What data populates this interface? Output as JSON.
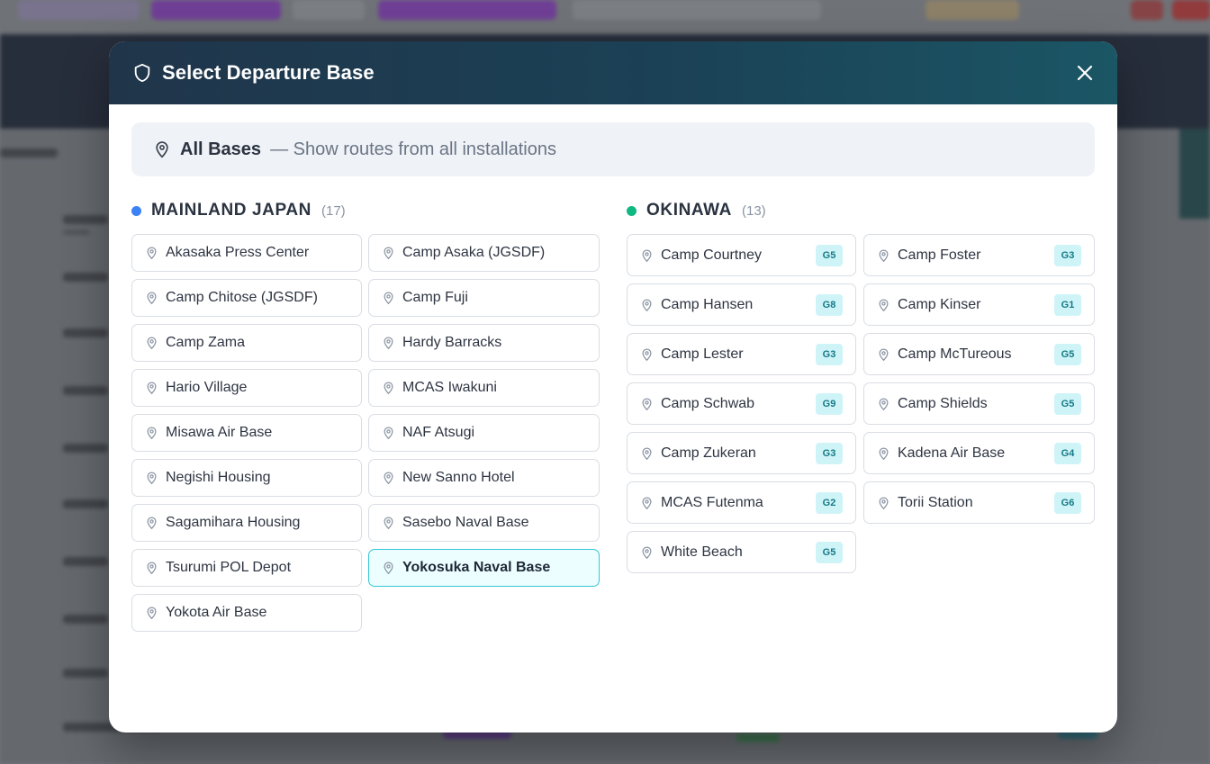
{
  "modal": {
    "title": "Select Departure Base",
    "all_bases": {
      "label": "All Bases",
      "description": "— Show routes from all installations"
    }
  },
  "regions": {
    "mainland": {
      "name": "MAINLAND JAPAN",
      "count": "(17)",
      "dot_color": "#3b82f6",
      "bases": [
        "Akasaka Press Center",
        "Camp Asaka (JGSDF)",
        "Camp Chitose (JGSDF)",
        "Camp Fuji",
        "Camp Zama",
        "Hardy Barracks",
        "Hario Village",
        "MCAS Iwakuni",
        "Misawa Air Base",
        "NAF Atsugi",
        "Negishi Housing",
        "New Sanno Hotel",
        "Sagamihara Housing",
        "Sasebo Naval Base",
        "Tsurumi POL Depot",
        "Yokosuka Naval Base",
        "Yokota Air Base"
      ],
      "selected": "Yokosuka Naval Base"
    },
    "okinawa": {
      "name": "OKINAWA",
      "count": "(13)",
      "dot_color": "#10b981",
      "bases": [
        {
          "name": "Camp Courtney",
          "gate": "G5"
        },
        {
          "name": "Camp Foster",
          "gate": "G3"
        },
        {
          "name": "Camp Hansen",
          "gate": "G8"
        },
        {
          "name": "Camp Kinser",
          "gate": "G1"
        },
        {
          "name": "Camp Lester",
          "gate": "G3"
        },
        {
          "name": "Camp McTureous",
          "gate": "G5"
        },
        {
          "name": "Camp Schwab",
          "gate": "G9"
        },
        {
          "name": "Camp Shields",
          "gate": "G5"
        },
        {
          "name": "Camp Zukeran",
          "gate": "G3"
        },
        {
          "name": "Kadena Air Base",
          "gate": "G4"
        },
        {
          "name": "MCAS Futenma",
          "gate": "G2"
        },
        {
          "name": "Torii Station",
          "gate": "G6"
        },
        {
          "name": "White Beach",
          "gate": "G5"
        }
      ]
    }
  },
  "icons": {
    "header": "shield-icon",
    "close": "close-icon",
    "location": "map-pin-icon"
  },
  "colors": {
    "header_start": "#20354a",
    "header_end": "#1b5665",
    "selected_bg": "#ecfeff",
    "selected_border": "#33c7d6",
    "gate_bg": "#cff4f8",
    "gate_text": "#147a86"
  }
}
